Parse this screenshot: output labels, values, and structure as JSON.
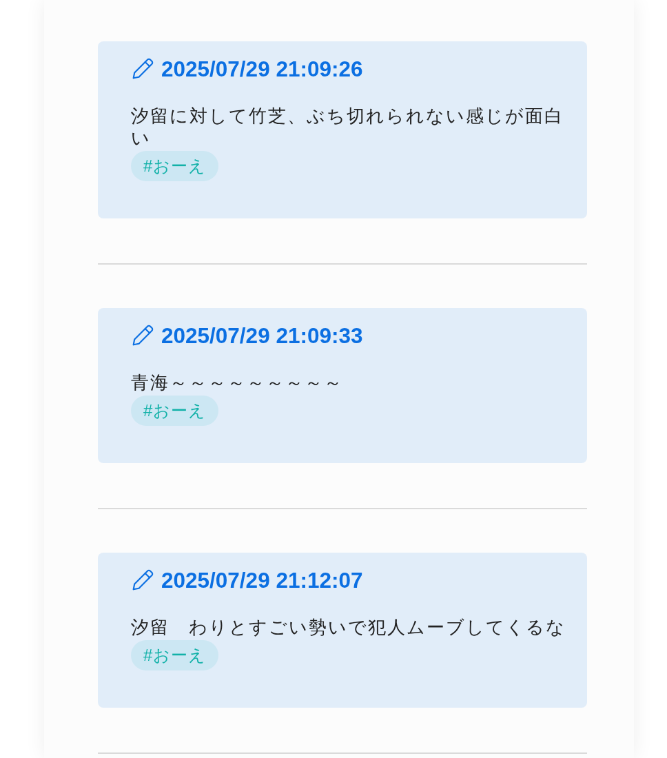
{
  "posts": [
    {
      "timestamp": "2025/07/29 21:09:26",
      "text": "汐留に対して竹芝、ぶち切れられない感じが面白い",
      "tags": [
        "#おーえ"
      ]
    },
    {
      "timestamp": "2025/07/29 21:09:33",
      "text": "青海～～～～～～～～～",
      "tags": [
        "#おーえ"
      ]
    },
    {
      "timestamp": "2025/07/29 21:12:07",
      "text": "汐留　わりとすごい勢いで犯人ムーブしてくるな",
      "tags": [
        "#おーえ"
      ]
    }
  ]
}
